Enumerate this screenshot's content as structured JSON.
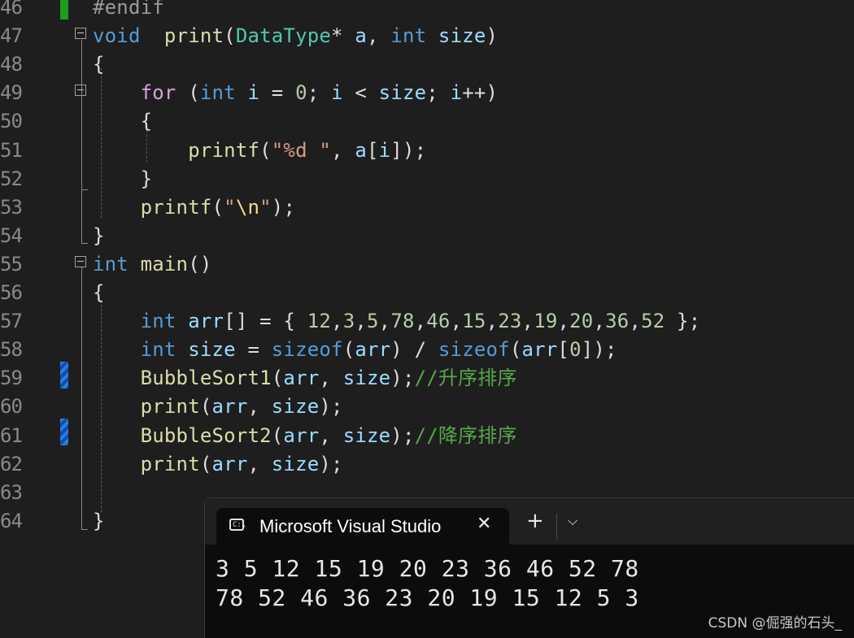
{
  "editor": {
    "lines": [
      {
        "n": "46",
        "code": [
          [
            "pp",
            "#endif"
          ]
        ]
      },
      {
        "n": "47",
        "code": [
          [
            "kw",
            "void"
          ],
          [
            "",
            "  "
          ],
          [
            "fn",
            "print"
          ],
          [
            "",
            "("
          ],
          [
            "ty",
            "DataType"
          ],
          [
            "",
            "* "
          ],
          [
            "var",
            "a"
          ],
          [
            "",
            ", "
          ],
          [
            "kw",
            "int"
          ],
          [
            "var",
            " size"
          ],
          [
            "",
            ")"
          ]
        ]
      },
      {
        "n": "48",
        "code": [
          [
            "",
            "{"
          ]
        ]
      },
      {
        "n": "49",
        "code": [
          [
            "",
            "    "
          ],
          [
            "kw2",
            "for"
          ],
          [
            "",
            " ("
          ],
          [
            "kw",
            "int"
          ],
          [
            "var",
            " i"
          ],
          [
            "",
            " = "
          ],
          [
            "num",
            "0"
          ],
          [
            "",
            "; "
          ],
          [
            "var",
            "i"
          ],
          [
            "",
            " < "
          ],
          [
            "var",
            "size"
          ],
          [
            "",
            "; "
          ],
          [
            "var",
            "i"
          ],
          [
            "",
            "++)"
          ]
        ]
      },
      {
        "n": "50",
        "code": [
          [
            "",
            "    {"
          ]
        ]
      },
      {
        "n": "51",
        "code": [
          [
            "",
            "        "
          ],
          [
            "fn",
            "printf"
          ],
          [
            "",
            "("
          ],
          [
            "str",
            "\"%d \""
          ],
          [
            "",
            ", "
          ],
          [
            "var",
            "a"
          ],
          [
            "",
            "["
          ],
          [
            "var",
            "i"
          ],
          [
            "",
            "]);"
          ]
        ]
      },
      {
        "n": "52",
        "code": [
          [
            "",
            "    }"
          ]
        ]
      },
      {
        "n": "53",
        "code": [
          [
            "",
            "    "
          ],
          [
            "fn",
            "printf"
          ],
          [
            "",
            "("
          ],
          [
            "str",
            "\""
          ],
          [
            "esc",
            "\\n"
          ],
          [
            "str",
            "\""
          ],
          [
            "",
            ");"
          ]
        ]
      },
      {
        "n": "54",
        "code": [
          [
            "",
            "}"
          ]
        ]
      },
      {
        "n": "55",
        "code": [
          [
            "kw",
            "int"
          ],
          [
            "",
            " "
          ],
          [
            "fn",
            "main"
          ],
          [
            "",
            "()"
          ]
        ]
      },
      {
        "n": "56",
        "code": [
          [
            "",
            "{"
          ]
        ]
      },
      {
        "n": "57",
        "code": [
          [
            "",
            "    "
          ],
          [
            "kw",
            "int"
          ],
          [
            "",
            " "
          ],
          [
            "var",
            "arr"
          ],
          [
            "",
            "[] = { "
          ],
          [
            "num",
            "12"
          ],
          [
            "",
            ","
          ],
          [
            "num",
            "3"
          ],
          [
            "",
            ","
          ],
          [
            "num",
            "5"
          ],
          [
            "",
            ","
          ],
          [
            "num",
            "78"
          ],
          [
            "",
            ","
          ],
          [
            "num",
            "46"
          ],
          [
            "",
            ","
          ],
          [
            "num",
            "15"
          ],
          [
            "",
            ","
          ],
          [
            "num",
            "23"
          ],
          [
            "",
            ","
          ],
          [
            "num",
            "19"
          ],
          [
            "",
            ","
          ],
          [
            "num",
            "20"
          ],
          [
            "",
            ","
          ],
          [
            "num",
            "36"
          ],
          [
            "",
            ","
          ],
          [
            "num",
            "52"
          ],
          [
            "",
            " };"
          ]
        ]
      },
      {
        "n": "58",
        "code": [
          [
            "",
            "    "
          ],
          [
            "kw",
            "int"
          ],
          [
            "",
            " "
          ],
          [
            "var",
            "size"
          ],
          [
            "",
            " = "
          ],
          [
            "kw",
            "sizeof"
          ],
          [
            "",
            "("
          ],
          [
            "var",
            "arr"
          ],
          [
            "",
            ") / "
          ],
          [
            "kw",
            "sizeof"
          ],
          [
            "",
            "("
          ],
          [
            "var",
            "arr"
          ],
          [
            "",
            "["
          ],
          [
            "num",
            "0"
          ],
          [
            "",
            "]);"
          ]
        ]
      },
      {
        "n": "59",
        "code": [
          [
            "",
            "    "
          ],
          [
            "fn",
            "BubbleSort1"
          ],
          [
            "",
            "("
          ],
          [
            "var",
            "arr"
          ],
          [
            "",
            ", "
          ],
          [
            "var",
            "size"
          ],
          [
            "",
            ");"
          ],
          [
            "cm",
            "//升序排序"
          ]
        ]
      },
      {
        "n": "60",
        "code": [
          [
            "",
            "    "
          ],
          [
            "fn",
            "print"
          ],
          [
            "",
            "("
          ],
          [
            "var",
            "arr"
          ],
          [
            "",
            ", "
          ],
          [
            "var",
            "size"
          ],
          [
            "",
            ");"
          ]
        ]
      },
      {
        "n": "61",
        "code": [
          [
            "",
            "    "
          ],
          [
            "fn",
            "BubbleSort2"
          ],
          [
            "",
            "("
          ],
          [
            "var",
            "arr"
          ],
          [
            "",
            ", "
          ],
          [
            "var",
            "size"
          ],
          [
            "",
            ");"
          ],
          [
            "cm",
            "//降序排序"
          ]
        ]
      },
      {
        "n": "62",
        "code": [
          [
            "",
            "    "
          ],
          [
            "fn",
            "print"
          ],
          [
            "",
            "("
          ],
          [
            "var",
            "arr"
          ],
          [
            "",
            ", "
          ],
          [
            "var",
            "size"
          ],
          [
            "",
            ");"
          ]
        ]
      },
      {
        "n": "63",
        "code": []
      },
      {
        "n": "64",
        "code": [
          [
            "",
            "}"
          ]
        ]
      }
    ]
  },
  "terminal": {
    "tab_title": "Microsoft Visual Studio",
    "tab_icon_text": "C:\\",
    "close_glyph": "✕",
    "new_tab_glyph": "+",
    "dropdown_glyph": "⌵",
    "output": [
      "3 5 12 15 19 20 23 36 46 52 78",
      "78 52 46 36 23 20 19 15 12 5 3"
    ]
  },
  "watermark": "CSDN @倔强的石头_",
  "colors": {
    "background": "#1e1e1e",
    "keyword": "#569cd6",
    "function": "#dcdcaa",
    "type": "#4ec9b0",
    "comment": "#57a64a",
    "terminal_bg": "#0c0c0c"
  }
}
